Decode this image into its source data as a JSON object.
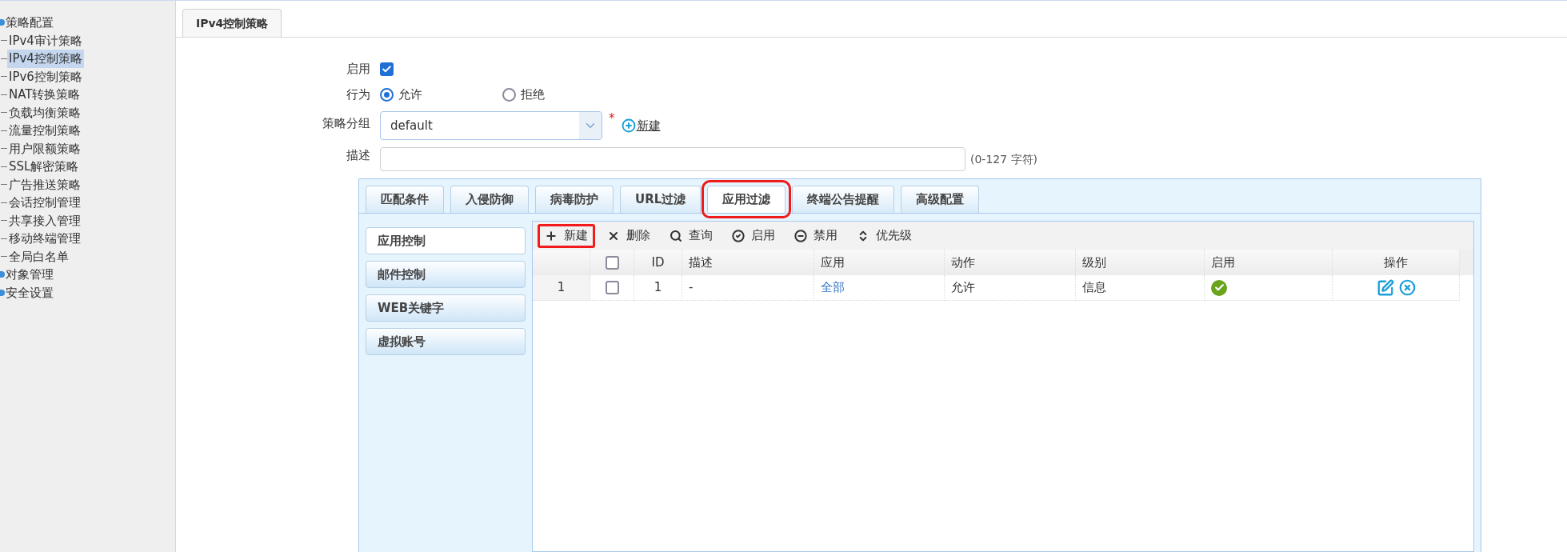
{
  "sidebar": {
    "items": [
      {
        "label": "策略配置",
        "children": [
          {
            "label": "IPv4审计策略",
            "selected": false
          },
          {
            "label": "IPv4控制策略",
            "selected": true
          },
          {
            "label": "IPv6控制策略",
            "selected": false
          },
          {
            "label": "NAT转换策略",
            "selected": false
          },
          {
            "label": "负载均衡策略",
            "selected": false
          },
          {
            "label": "流量控制策略",
            "selected": false
          },
          {
            "label": "用户限额策略",
            "selected": false
          },
          {
            "label": "SSL解密策略",
            "selected": false
          },
          {
            "label": "广告推送策略",
            "selected": false
          },
          {
            "label": "会话控制管理",
            "selected": false
          },
          {
            "label": "共享接入管理",
            "selected": false
          },
          {
            "label": "移动终端管理",
            "selected": false
          },
          {
            "label": "全局白名单",
            "selected": false
          }
        ]
      },
      {
        "label": "对象管理"
      },
      {
        "label": "安全设置"
      }
    ]
  },
  "page_tabs": [
    {
      "label": "IPv4控制策略",
      "selected": true
    }
  ],
  "form": {
    "enabled": {
      "label": "启用",
      "checked": true
    },
    "action": {
      "label": "行为",
      "options": [
        {
          "label": "允许",
          "selected": true
        },
        {
          "label": "拒绝",
          "selected": false
        }
      ]
    },
    "group": {
      "label": "策略分组",
      "value": "default",
      "required_mark": "*",
      "new_link": "新建"
    },
    "description": {
      "label": "描述",
      "hint": "(0-127 字符)"
    }
  },
  "filter_tabs": [
    {
      "label": "匹配条件",
      "selected": false,
      "highlighted": false
    },
    {
      "label": "入侵防御",
      "selected": false,
      "highlighted": false
    },
    {
      "label": "病毒防护",
      "selected": false,
      "highlighted": false
    },
    {
      "label": "URL过滤",
      "selected": false,
      "highlighted": false
    },
    {
      "label": "应用过滤",
      "selected": true,
      "highlighted": true
    },
    {
      "label": "终端公告提醒",
      "selected": false,
      "highlighted": false
    },
    {
      "label": "高级配置",
      "selected": false,
      "highlighted": false
    }
  ],
  "sub_menu": [
    {
      "label": "应用控制",
      "selected": true
    },
    {
      "label": "邮件控制",
      "selected": false
    },
    {
      "label": "WEB关键字",
      "selected": false
    },
    {
      "label": "虚拟账号",
      "selected": false
    }
  ],
  "toolbar": [
    {
      "kind": "add",
      "label": "新建",
      "highlighted": true
    },
    {
      "kind": "delete",
      "label": "删除",
      "highlighted": false
    },
    {
      "kind": "search",
      "label": "查询",
      "highlighted": false
    },
    {
      "kind": "enable",
      "label": "启用",
      "highlighted": false
    },
    {
      "kind": "disable",
      "label": "禁用",
      "highlighted": false
    },
    {
      "kind": "priority",
      "label": "优先级",
      "highlighted": false
    }
  ],
  "table": {
    "header_checked": false,
    "columns": [
      "ID",
      "描述",
      "应用",
      "动作",
      "级别",
      "启用",
      "操作"
    ],
    "rows": [
      {
        "index": "1",
        "checked": false,
        "id": "1",
        "description": "-",
        "app": "全部",
        "action": "允许",
        "level": "信息",
        "enabled": true
      }
    ]
  }
}
